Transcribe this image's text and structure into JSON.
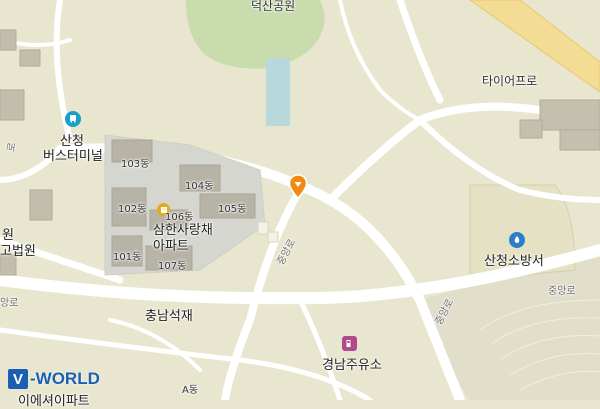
{
  "map": {
    "labels": {
      "park": "덕산공원",
      "tire_pro": "타이어프로",
      "bus_terminal_line1": "산청",
      "bus_terminal_line2": "버스터미널",
      "dong103": "103동",
      "dong104": "104동",
      "dong102": "102동",
      "dong105": "105동",
      "dong106": "106동",
      "dong101": "101동",
      "dong107": "107동",
      "apt_line1": "삼한사랑채",
      "apt_line2": "아파트",
      "court_partial_a": "원",
      "court_partial_b": "고법원",
      "fire_station": "산청소방서",
      "road_jungang_1": "중앙로",
      "road_jungang_2": "중앙로",
      "road_jungang_3": "중앙로",
      "road_left": "앙로",
      "road_left_top": "로",
      "chungnam_seokjae": "충남석재",
      "gyeongnam_gas": "경남주유소",
      "dong_a": "A동",
      "bottom_apt": "이에셔이파트"
    },
    "brand": {
      "v": "V",
      "word": "-WORLD"
    },
    "icons": {
      "bus_icon": "bus-icon",
      "fire_icon": "fire-station-icon",
      "gas_icon": "gas-station-icon",
      "pin_icon": "location-pin-icon",
      "bldg_icon": "building-icon"
    },
    "colors": {
      "background": "#e9e6cf",
      "road": "#ffffff",
      "park": "#c9dcae",
      "building": "#bdbdbd",
      "marker": "#f08a12",
      "brand": "#1b5fb4",
      "highway": "#f3dc94",
      "bus": "#1aa0c8",
      "fire": "#2b7fc8",
      "gas": "#b04a8d"
    }
  }
}
